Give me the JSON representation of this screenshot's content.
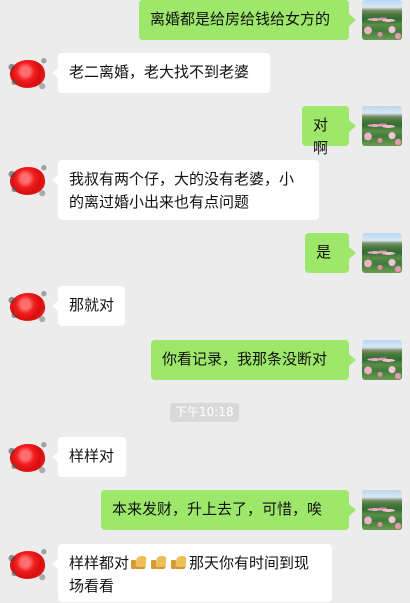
{
  "time_label": "下午10:18",
  "messages": [
    {
      "side": "right",
      "text": "离婚都是给房给钱给女方的"
    },
    {
      "side": "left",
      "text": "老二离婚，老大找不到老婆"
    },
    {
      "side": "right",
      "text": "对啊"
    },
    {
      "side": "left",
      "text": "我叔有两个仔，大的没有老婆，小的离过婚小出来也有点问题"
    },
    {
      "side": "right",
      "text": "是"
    },
    {
      "side": "left",
      "text": "那就对"
    },
    {
      "side": "right",
      "text": "你看记录，我那条没断对"
    },
    {
      "side": "left",
      "text": "样样对"
    },
    {
      "side": "right",
      "text": "本来发财，升上去了，可惜，唉"
    },
    {
      "side": "left",
      "text_before": "样样都对",
      "text_after": "那天你有时间到现场看看",
      "emoji": [
        "thumbs-up",
        "thumbs-up",
        "thumbs-up"
      ]
    }
  ],
  "avatars": {
    "right": "flower-field-photo",
    "left": "red-scribble-avatar"
  }
}
